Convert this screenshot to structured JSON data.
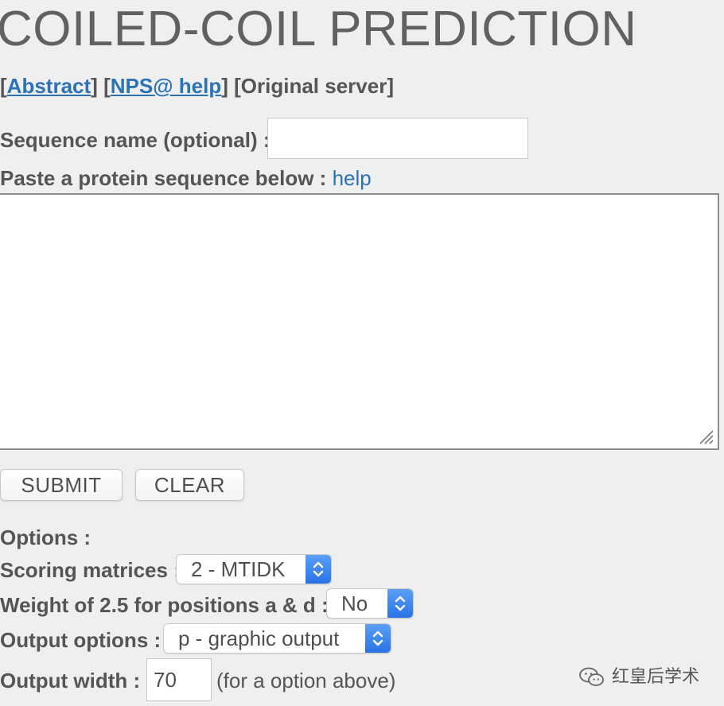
{
  "page": {
    "title": "COILED-COIL PREDICTION"
  },
  "links": {
    "abstract": "Abstract",
    "nps_help": "NPS@ help",
    "original_server": "[Original server]"
  },
  "form": {
    "sequence_name_label": "Sequence name (optional) :",
    "sequence_name_value": "",
    "paste_label": "Paste a protein sequence below :",
    "paste_help": "help",
    "sequence_value": ""
  },
  "buttons": {
    "submit": "SUBMIT",
    "clear": "CLEAR"
  },
  "options": {
    "header": "Options :",
    "scoring_label": "Scoring matrices :",
    "scoring_value": "2 - MTIDK",
    "weight_label": "Weight of 2.5 for positions a & d :",
    "weight_value": "No",
    "output_label": "Output options :",
    "output_value": "p - graphic output",
    "width_label": "Output width :",
    "width_value": "70",
    "width_hint": "(for a option above)"
  },
  "watermark": {
    "text": "红皇后学术",
    "icon": "wechat-icon"
  },
  "colors": {
    "background": "#efefef",
    "link": "#2b73b6",
    "text": "#555555",
    "select_arrow": "#2a72e6"
  }
}
